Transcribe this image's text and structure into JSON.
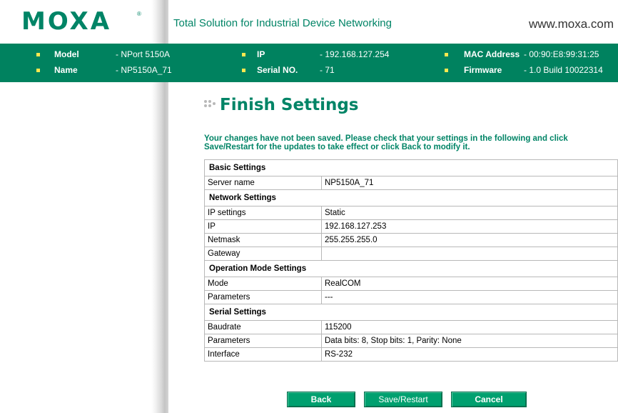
{
  "header": {
    "logo": "MOXA",
    "logo_mark": "®",
    "tagline": "Total Solution for Industrial Device Networking",
    "website": "www.moxa.com"
  },
  "infobar": {
    "model": {
      "label": "Model",
      "value": "- NPort 5150A"
    },
    "name": {
      "label": "Name",
      "value": "- NP5150A_71"
    },
    "ip": {
      "label": "IP",
      "value": "- 192.168.127.254"
    },
    "serial": {
      "label": "Serial NO.",
      "value": "- 71"
    },
    "mac": {
      "label": "MAC Address",
      "value": "- 00:90:E8:99:31:25"
    },
    "firmware": {
      "label": "Firmware",
      "value": "- 1.0 Build 10022314"
    }
  },
  "page": {
    "title": "Finish Settings",
    "message": "Your changes have not been saved. Please check that your settings in the following and click Save/Restart for the updates to take effect or click Back to modify it."
  },
  "sections": {
    "basic": {
      "title": "Basic Settings",
      "rows": [
        {
          "label": "Server name",
          "value": "NP5150A_71"
        }
      ]
    },
    "network": {
      "title": "Network Settings",
      "rows": [
        {
          "label": "IP settings",
          "value": "Static"
        },
        {
          "label": "IP",
          "value": "192.168.127.253"
        },
        {
          "label": "Netmask",
          "value": "255.255.255.0"
        },
        {
          "label": "Gateway",
          "value": ""
        }
      ]
    },
    "opmode": {
      "title": "Operation Mode Settings",
      "rows": [
        {
          "label": "Mode",
          "value": "RealCOM"
        },
        {
          "label": "Parameters",
          "value": "---"
        }
      ]
    },
    "serial": {
      "title": "Serial Settings",
      "rows": [
        {
          "label": "Baudrate",
          "value": "115200"
        },
        {
          "label": "Parameters",
          "value": "Data bits: 8, Stop bits: 1, Parity: None"
        },
        {
          "label": "Interface",
          "value": "RS-232"
        }
      ]
    }
  },
  "buttons": {
    "back": "Back",
    "save_restart": "Save/Restart",
    "cancel": "Cancel"
  },
  "colors": {
    "brand_green": "#008466",
    "infobar_green": "#00825f",
    "button_green": "#00a06f",
    "bullet_yellow": "#ffe84f"
  }
}
